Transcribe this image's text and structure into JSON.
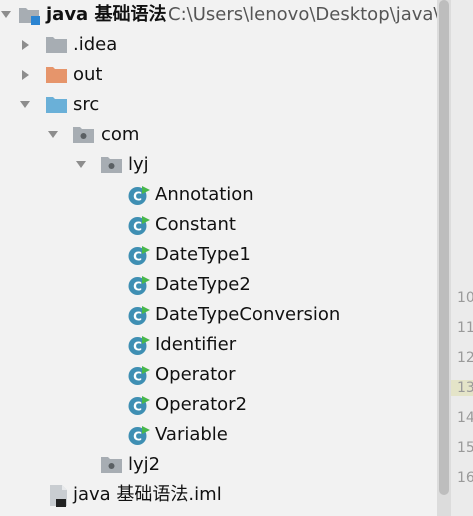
{
  "project_tree": {
    "root": {
      "name": "java 基础语法",
      "path": "C:\\Users\\lenovo\\Desktop\\java\\coo",
      "expanded": true
    },
    "nodes": [
      {
        "id": "idea",
        "label": ".idea",
        "type": "folder",
        "color": "#a7adb3",
        "expanded": false
      },
      {
        "id": "out",
        "label": "out",
        "type": "folder",
        "color": "#e6956b",
        "expanded": false
      },
      {
        "id": "src",
        "label": "src",
        "type": "folder",
        "color": "#6ab0d8",
        "expanded": true
      },
      {
        "id": "com",
        "label": "com",
        "type": "package",
        "expanded": true
      },
      {
        "id": "lyj",
        "label": "lyj",
        "type": "package",
        "expanded": true
      },
      {
        "id": "annotation",
        "label": "Annotation",
        "type": "class"
      },
      {
        "id": "constant",
        "label": "Constant",
        "type": "class"
      },
      {
        "id": "datetype1",
        "label": "DateType1",
        "type": "class"
      },
      {
        "id": "datetype2",
        "label": "DateType2",
        "type": "class"
      },
      {
        "id": "datetypeconversion",
        "label": "DateTypeConversion",
        "type": "class"
      },
      {
        "id": "identifier",
        "label": "Identifier",
        "type": "class"
      },
      {
        "id": "operator",
        "label": "Operator",
        "type": "class"
      },
      {
        "id": "operator2",
        "label": "Operator2",
        "type": "class"
      },
      {
        "id": "variable",
        "label": "Variable",
        "type": "class"
      },
      {
        "id": "lyj2",
        "label": "lyj2",
        "type": "package",
        "expanded": false
      },
      {
        "id": "iml",
        "label": "java 基础语法.iml",
        "type": "module-file"
      }
    ]
  },
  "gutter": {
    "line_numbers": [
      "10",
      "11",
      "12",
      "13",
      "14",
      "15",
      "16"
    ],
    "current_line": "13"
  },
  "colors": {
    "class_icon": "#3f8fb3",
    "run_marker": "#47b84b",
    "package_icon": "#a7adb3",
    "arrow": "#8d8d8d"
  }
}
